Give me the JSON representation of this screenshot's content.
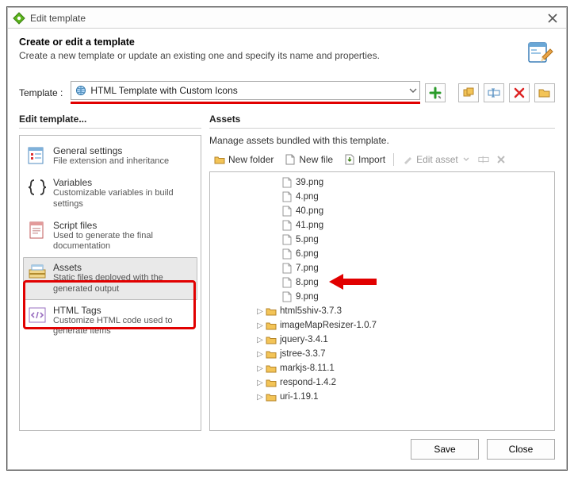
{
  "title": "Edit template",
  "intro": {
    "heading": "Create or edit a template",
    "sub": "Create a new template or update an existing one and specify its name and properties."
  },
  "template_label": "Template :",
  "template_value": "HTML Template with Custom Icons",
  "panels": {
    "left_title": "Edit template...",
    "right_title": "Assets",
    "right_sub": "Manage assets bundled with this template."
  },
  "nav": [
    {
      "title": "General settings",
      "desc": "File extension and inheritance"
    },
    {
      "title": "Variables",
      "desc": "Customizable variables in build settings"
    },
    {
      "title": "Script files",
      "desc": "Used to generate the final documentation"
    },
    {
      "title": "Assets",
      "desc": "Static files deployed with the generated output"
    },
    {
      "title": "HTML Tags",
      "desc": "Customize HTML code used to generate items"
    }
  ],
  "asset_toolbar": {
    "new_folder": "New folder",
    "new_file": "New file",
    "import": "Import",
    "edit_asset": "Edit asset"
  },
  "files": [
    "39.png",
    "4.png",
    "40.png",
    "41.png",
    "5.png",
    "6.png",
    "7.png",
    "8.png",
    "9.png"
  ],
  "folders": [
    "html5shiv-3.7.3",
    "imageMapResizer-1.0.7",
    "jquery-3.4.1",
    "jstree-3.3.7",
    "markjs-8.11.1",
    "respond-1.4.2",
    "uri-1.19.1"
  ],
  "footer": {
    "save": "Save",
    "close": "Close"
  }
}
